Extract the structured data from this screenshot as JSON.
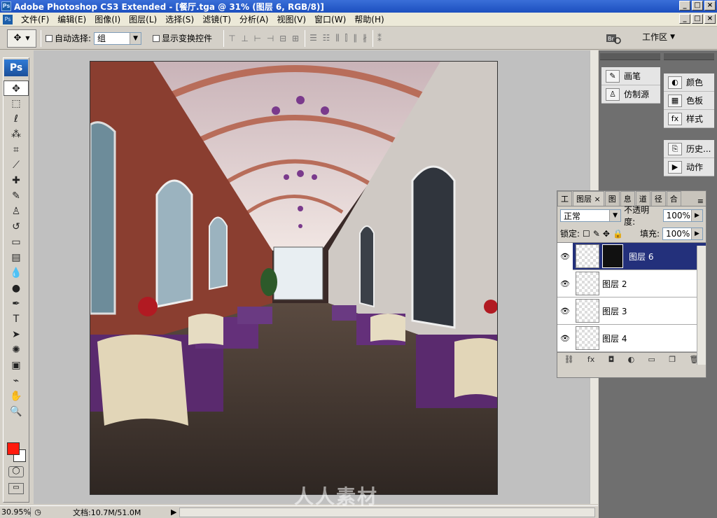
{
  "app": {
    "title": "Adobe Photoshop CS3 Extended - [餐厅.tga @ 31% (图层 6, RGB/8)]",
    "logo": "Ps"
  },
  "menu": [
    "文件(F)",
    "编辑(E)",
    "图像(I)",
    "图层(L)",
    "选择(S)",
    "滤镜(T)",
    "分析(A)",
    "视图(V)",
    "窗口(W)",
    "帮助(H)"
  ],
  "options": {
    "auto_select_label": "自动选择:",
    "auto_select_value": "组",
    "show_transform_label": "显示变换控件",
    "workspace_label": "工作区"
  },
  "dock": {
    "left": [
      "画笔",
      "仿制源"
    ],
    "right": [
      "颜色",
      "色板",
      "样式"
    ],
    "history": [
      "历史...",
      "动作"
    ]
  },
  "layers": {
    "tabs": [
      "工",
      "图层",
      "图",
      "息",
      "道",
      "径",
      "合"
    ],
    "blend_mode": "正常",
    "opacity_label": "不透明度:",
    "opacity": "100%",
    "lock_label": "锁定:",
    "fill_label": "填充:",
    "fill": "100%",
    "items": [
      {
        "name": "图层 6",
        "selected": true
      },
      {
        "name": "图层 2",
        "selected": false
      },
      {
        "name": "图层 3",
        "selected": false
      },
      {
        "name": "图层 4",
        "selected": false
      }
    ]
  },
  "status": {
    "zoom": "30.95%",
    "doc_label": "文档:10.7M/51.0M"
  },
  "watermark": "人人素材",
  "colors": {
    "foreground": "#ff1a0d",
    "background": "#ffffff",
    "title_bar": "#2a5fcf",
    "selected_layer": "#23307b"
  },
  "icons": [
    "move-tool-icon",
    "marquee-icon",
    "lasso-icon",
    "magic-wand-icon",
    "crop-icon",
    "slice-icon",
    "healing-icon",
    "brush-icon",
    "stamp-icon",
    "history-brush-icon",
    "eraser-icon",
    "gradient-icon",
    "blur-icon",
    "dodge-icon",
    "pen-icon",
    "type-icon",
    "path-select-icon",
    "shape-icon",
    "notes-icon",
    "eyedropper-icon",
    "hand-icon",
    "zoom-icon"
  ]
}
